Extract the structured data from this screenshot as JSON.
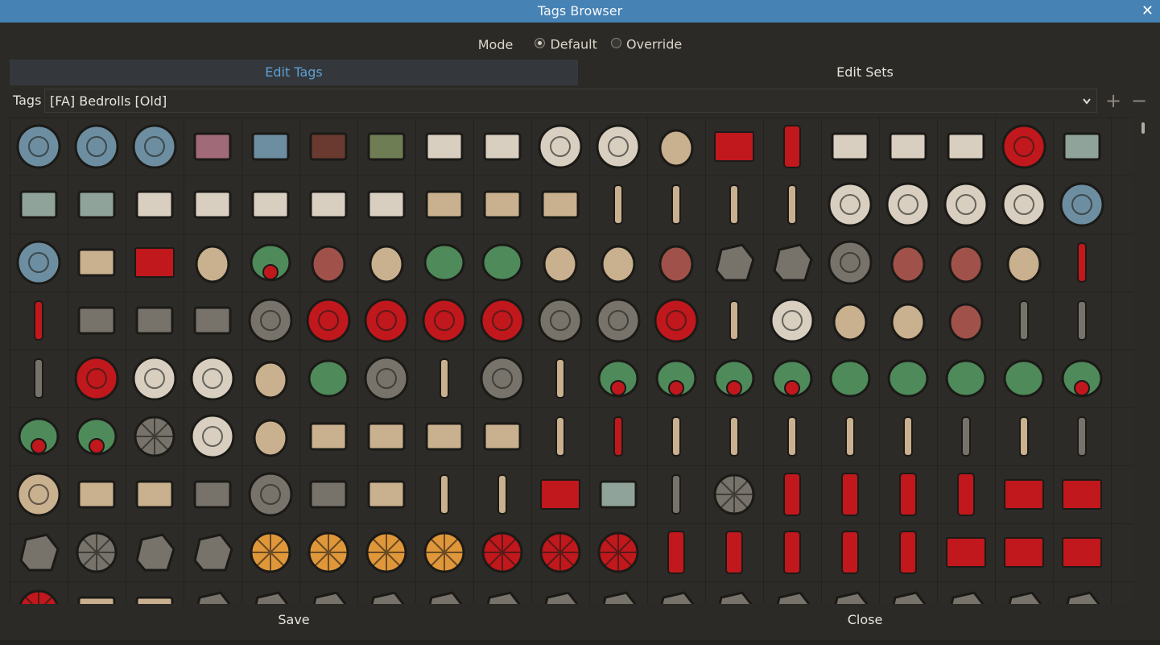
{
  "window": {
    "title": "Tags Browser",
    "close_glyph": "✕"
  },
  "mode": {
    "label": "Mode",
    "options": [
      {
        "label": "Default",
        "selected": true
      },
      {
        "label": "Override",
        "selected": false
      }
    ]
  },
  "tabs": [
    {
      "label": "Edit Tags",
      "active": true
    },
    {
      "label": "Edit Sets",
      "active": false
    }
  ],
  "tags": {
    "label": "Tags",
    "selected": "[FA] Bedrolls [Old]",
    "add_glyph": "+",
    "remove_glyph": "−"
  },
  "asset_grid": {
    "rows": [
      [
        "globe-icon",
        "no-globe-icon",
        "no-globe-icon",
        "book-pink-icon",
        "book-blue-icon",
        "book-brown-icon",
        "book-green-icon",
        "book-closed-icon",
        "open-book-icon",
        "clock-icon",
        "clock-icon",
        "gear-chain-icon",
        "red-flag-icon",
        "red-banner-icon",
        "envelope-icon",
        "envelope-icon",
        "envelope-icon",
        "red-lens-icon",
        "map-icon"
      ],
      [
        "map-icon",
        "map-icon",
        "paper-icon",
        "paper-icon",
        "paper-icon",
        "paper-icon",
        "paper-icon",
        "books-icon",
        "books-icon",
        "books-icon",
        "scroll-icon",
        "stick-icon",
        "stick-icon",
        "stick-icon",
        "mushroom-plate-icon",
        "mushroom-plate-icon",
        "mushroom-plate-icon",
        "mushroom-plate-icon",
        "basin-icon"
      ],
      [
        "rug-icon",
        "crate-icon",
        "red-cloth-icon",
        "plank-icon",
        "carrot-icon",
        "chicken-leg-icon",
        "fish-icon",
        "herb-icon",
        "leek-icon",
        "onion-icon",
        "onion-icon",
        "red-pepper-icon",
        "stove-icon",
        "stove-icon",
        "pan-icon",
        "sausage-icon",
        "apple-icon",
        "seeds-icon",
        "hanging-meat-icon"
      ],
      [
        "hanging-meat-icon",
        "console-icon",
        "console-icon",
        "console-icon",
        "burner-icon",
        "berry-bowl-icon",
        "red-bowl-icon",
        "red-bowl-icon",
        "red-pot-icon",
        "pot-icon",
        "pot-icon",
        "red-ring-icon",
        "bottle-icon",
        "egg-pan-icon",
        "bread-icon",
        "baguette-icon",
        "ham-icon",
        "fork-icon",
        "knife-icon"
      ],
      [
        "knife-icon",
        "meat-bowl-icon",
        "plate-icon",
        "plate-icon",
        "sack-icon",
        "leaf-icon",
        "pan-icon",
        "ladle-icon",
        "pan-icon",
        "spoon-icon",
        "radish-icon",
        "radish-icon",
        "radish-icon",
        "radish-icon",
        "cabbage-icon",
        "cabbage-icon",
        "cabbage-icon",
        "cabbage-icon",
        "radish-icon"
      ],
      [
        "radish-icon",
        "radish-icon",
        "spinner-icon",
        "clock-icon",
        "chopped-wood-icon",
        "woodpile-icon",
        "woodpile-icon",
        "board-icon",
        "log-icon",
        "lantern-icon",
        "red-lantern-icon",
        "rod-icon",
        "rod-icon",
        "lamp-icon",
        "lamp-icon",
        "hanging-gourd-icon",
        "pickaxe-icon",
        "arrowhead-icon",
        "spear-icon"
      ],
      [
        "tree-ring-icon",
        "table-icon",
        "table-icon",
        "fireplace-icon",
        "stone-ring-icon",
        "oven-icon",
        "loom-icon",
        "signpost-icon",
        "hammer-icon",
        "red-mat-icon",
        "window-icon",
        "tongs-icon",
        "gears-icon",
        "bedroll-icon",
        "bedroll-icon",
        "bedroll-icon",
        "bedroll-icon",
        "red-mat-icon",
        "red-mat-icon"
      ],
      [
        "rock-icon",
        "spiked-icon",
        "rock-icon",
        "rocks-icon",
        "campfire-icon",
        "campfire-icon",
        "campfire-icon",
        "campfire-icon",
        "parasol-icon",
        "parasol-icon",
        "parasol-icon",
        "banner-icon",
        "banner-icon",
        "banner-icon",
        "banner-icon",
        "banner-icon",
        "tent-icon",
        "tent-icon",
        "tent-icon"
      ],
      [
        "parasol-icon",
        "chest-icon",
        "chest-icon",
        "rock-icon",
        "rock-icon",
        "rock-icon",
        "rock-icon",
        "rock-icon",
        "rock-icon",
        "rock-icon",
        "rock-icon",
        "rock-icon",
        "rock-icon",
        "rock-icon",
        "rock-icon",
        "rock-icon",
        "rock-icon",
        "rock-icon",
        "rock-icon"
      ]
    ]
  },
  "footer": {
    "save_label": "Save",
    "close_label": "Close"
  },
  "colors": {
    "accent": "#4682b4",
    "tab_active_text": "#5e9fd4",
    "background": "#2b2a26",
    "icon_red": "#c0181c"
  }
}
